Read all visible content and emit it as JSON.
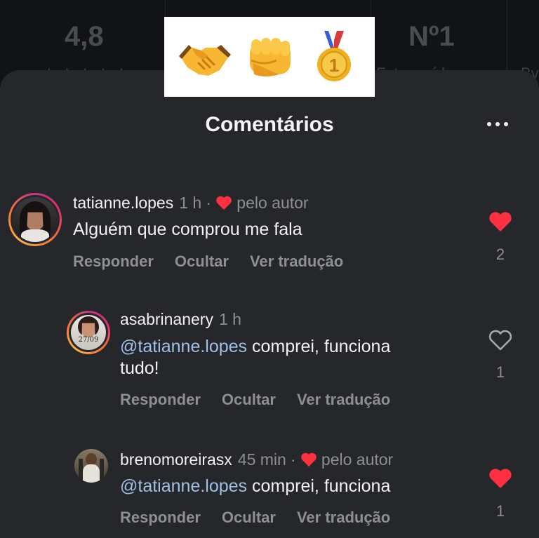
{
  "background": {
    "stat_left": "4,8",
    "stat_right": "Nº1",
    "sub_right": "Foto e vídeo",
    "sub_far": "By"
  },
  "sheet": {
    "title": "Comentários"
  },
  "comments": [
    {
      "username": "tatianne.lopes",
      "time": "1 h",
      "author_like": "pelo autor",
      "text": "Alguém que comprou me fala",
      "likes": "2",
      "liked": true,
      "actions": [
        "Responder",
        "Ocultar",
        "Ver tradução"
      ]
    },
    {
      "username": "asabrinanery",
      "time": "1 h",
      "mention": "@tatianne.lopes",
      "text": "comprei, funciona",
      "text_line2": "tudo!",
      "avatar_label": "27/09",
      "likes": "1",
      "liked": false,
      "actions": [
        "Responder",
        "Ocultar",
        "Ver tradução"
      ]
    },
    {
      "username": "brenomoreirasx",
      "time": "45 min",
      "author_like": "pelo autor",
      "mention": "@tatianne.lopes",
      "text": "comprei, funciona",
      "likes": "1",
      "liked": true,
      "actions": [
        "Responder",
        "Ocultar",
        "Ver tradução"
      ]
    }
  ],
  "colors": {
    "heart_red": "#ff3040",
    "mention_blue": "#9fc0e6",
    "sheet_bg": "#26272b"
  },
  "icons": [
    "handshake-icon",
    "fist-icon",
    "gold-medal-icon",
    "more-options-icon",
    "heart-icon"
  ]
}
